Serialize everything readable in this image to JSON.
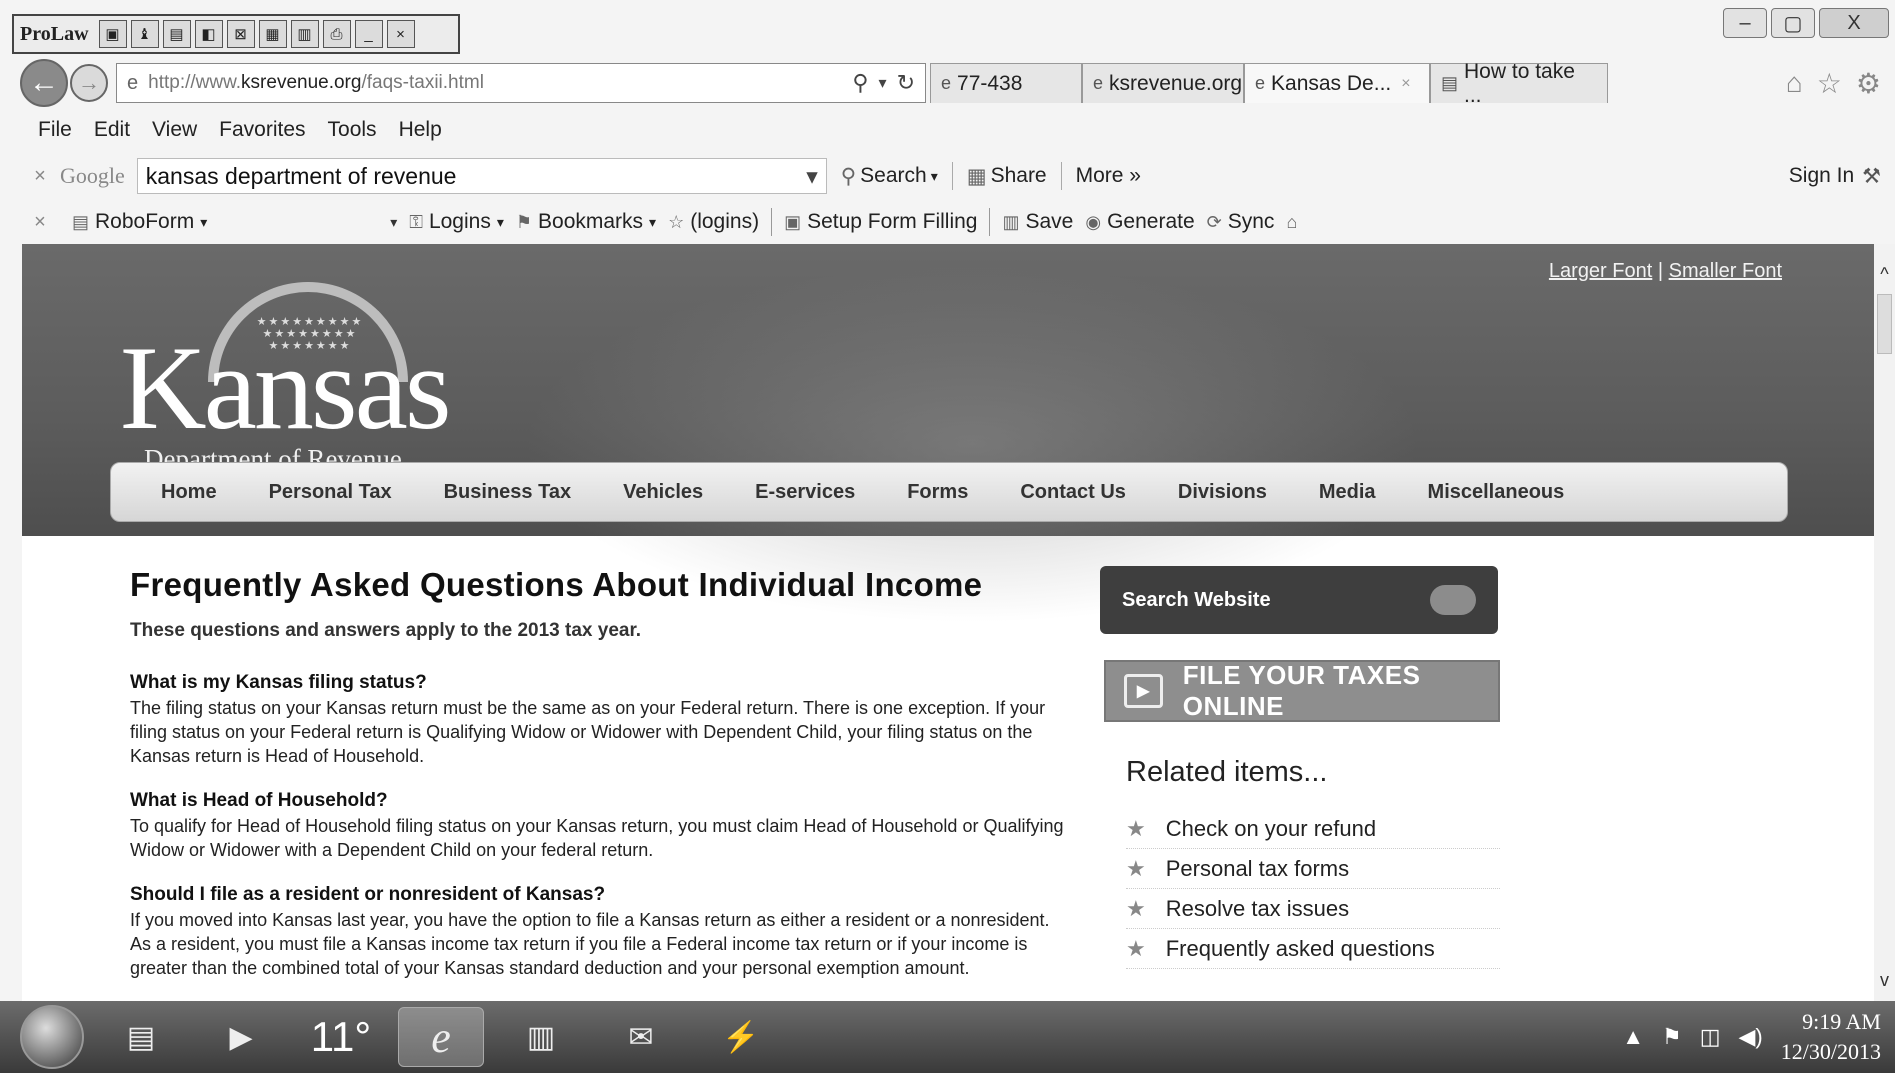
{
  "prolaw": {
    "title": "ProLaw",
    "buttons": [
      "▣",
      "♝",
      "▤",
      "◧",
      "⊠",
      "▦",
      "▥",
      "⎙",
      "_",
      "×"
    ]
  },
  "window": {
    "minimize": "–",
    "maximize": "▢",
    "close": "X"
  },
  "address": {
    "back": "←",
    "forward": "→",
    "url_prefix": "http://www.",
    "url_domain": "ksrevenue.org",
    "url_path": "/faqs-taxii.html",
    "search_icon": "⚲",
    "dropdown_icon": "▾",
    "refresh_icon": "↻"
  },
  "tabs": [
    {
      "label": "77-438",
      "icon": "ie-icon"
    },
    {
      "label": "ksrevenue.org",
      "icon": "ie-icon"
    },
    {
      "label": "Kansas De...",
      "icon": "ie-icon",
      "close": "×"
    },
    {
      "label": "How to take ...",
      "icon": "page-icon"
    }
  ],
  "navicons": {
    "home": "⌂",
    "favorites": "☆",
    "settings": "⚙"
  },
  "menu": [
    "File",
    "Edit",
    "View",
    "Favorites",
    "Tools",
    "Help"
  ],
  "google_bar": {
    "close": "×",
    "logo": "Google",
    "query": "kansas department of revenue",
    "dropdown": "▾",
    "search_label": "Search",
    "share_label": "Share",
    "more_label": "More »",
    "signin_label": "Sign In",
    "wrench": "🔧"
  },
  "roboform_bar": {
    "close": "×",
    "roboform_label": "RoboForm",
    "logins_label": "Logins",
    "bookmarks_label": "Bookmarks",
    "logins_paren": "(logins)",
    "setup_label": "Setup Form Filling",
    "save_label": "Save",
    "generate_label": "Generate",
    "sync_label": "Sync"
  },
  "site": {
    "larger_font": "Larger Font",
    "font_sep": "|",
    "smaller_font": "Smaller Font",
    "logo_word": "Kansas",
    "logo_sub": "Department of Revenue",
    "nav": [
      "Home",
      "Personal Tax",
      "Business Tax",
      "Vehicles",
      "E-services",
      "Forms",
      "Contact Us",
      "Divisions",
      "Media",
      "Miscellaneous"
    ]
  },
  "content": {
    "title": "Frequently Asked Questions About Individual Income",
    "intro": "These questions and answers apply to the 2013 tax year.",
    "qa": [
      {
        "q": "What is my Kansas filing status?",
        "a": "The filing status on your Kansas return must be the same as on your Federal return. There is one exception. If your filing status on your Federal return is Qualifying Widow or Widower with Dependent Child, your filing status on the Kansas return is Head of Household."
      },
      {
        "q": "What is Head of Household?",
        "a": "To qualify for Head of Household filing status on your Kansas return, you must claim Head of Household or Qualifying Widow or Widower with a Dependent Child on your federal return."
      },
      {
        "q": "Should I file as a resident or nonresident of Kansas?",
        "a": "If you moved into Kansas last year, you have the option to file a Kansas return as either a resident or a nonresident. As a resident, you must file a Kansas income tax return if you file a Federal income tax return or if your income is greater than the combined total of your Kansas standard deduction and your personal exemption amount."
      }
    ]
  },
  "sidebar": {
    "search_label": "Search Website",
    "file_online": "FILE YOUR TAXES ONLINE",
    "related_title": "Related items...",
    "related": [
      "Check on your refund",
      "Personal tax forms",
      "Resolve tax issues",
      "Frequently asked questions"
    ]
  },
  "taskbar": {
    "temperature": "11°",
    "time": "9:19 AM",
    "date": "12/30/2013"
  },
  "scroll": {
    "up": "^",
    "down": "v"
  }
}
